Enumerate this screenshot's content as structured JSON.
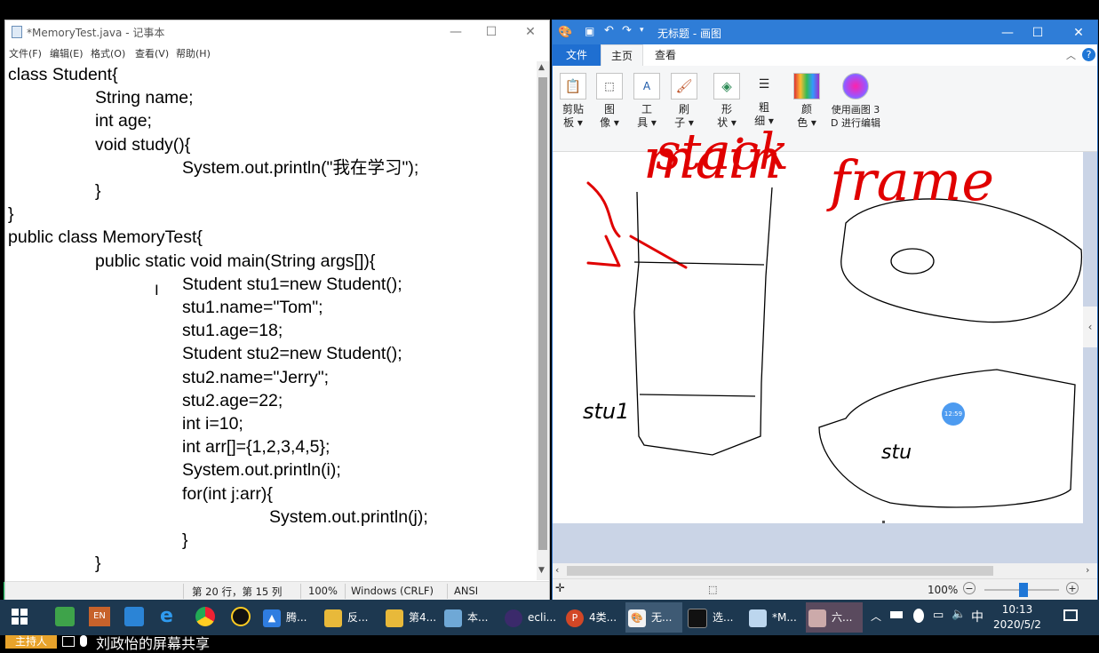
{
  "notepad": {
    "title": "*MemoryTest.java - 记事本",
    "menu": [
      "文件(F)",
      "编辑(E)",
      "格式(O)",
      "查看(V)",
      "帮助(H)"
    ],
    "code_lines": [
      "class Student{",
      "\t\tString name;",
      "\t\tint age;",
      "\t\tvoid study(){",
      "\t\t\t\tSystem.out.println(\"我在学习\");",
      "\t\t}",
      "}",
      "public class MemoryTest{",
      "\t\tpublic static void main(String args[]){",
      "\t\t\t\tStudent stu1=new Student();",
      "\t\t\t\tstu1.name=\"Tom\";",
      "\t\t\t\tstu1.age=18;",
      "\t\t\t\tStudent stu2=new Student();",
      "\t\t\t\tstu2.name=\"Jerry\";",
      "\t\t\t\tstu2.age=22;",
      "\t\t\t\tint i=10;",
      "\t\t\t\tint arr[]={1,2,3,4,5};",
      "\t\t\t\tSystem.out.println(i);",
      "\t\t\t\tfor(int j:arr){",
      "\t\t\t\t\t\tSystem.out.println(j);",
      "\t\t\t\t}",
      "\t\t}"
    ],
    "status": {
      "position": "第 20 行，第 15 列",
      "zoom": "100%",
      "line_ending": "Windows (CRLF)",
      "encoding": "ANSI"
    }
  },
  "paint": {
    "title": "无标题 - 画图",
    "tabs": [
      "文件",
      "主页",
      "查看"
    ],
    "ribbon": [
      {
        "line1": "剪贴",
        "line2": "板 ▾",
        "icon": "clipboard-icon"
      },
      {
        "line1": "图",
        "line2": "像 ▾",
        "icon": "image-select-icon"
      },
      {
        "line1": "工",
        "line2": "具 ▾",
        "icon": "tools-icon"
      },
      {
        "line1": "刷",
        "line2": "子 ▾",
        "icon": "brush-icon"
      },
      {
        "line1": "形",
        "line2": "状 ▾",
        "icon": "shapes-icon"
      },
      {
        "line1": "粗",
        "line2": "细 ▾",
        "icon": "size-icon"
      },
      {
        "line1": "颜",
        "line2": "色 ▾",
        "icon": "colors-icon"
      },
      {
        "line1": "使用画图 3",
        "line2": "D 进行编辑",
        "icon": "paint3d-icon"
      }
    ],
    "handwriting": {
      "main": "main",
      "stack": "stack",
      "frame": "frame",
      "stu1": "stu1",
      "stu": "stu"
    },
    "cursor_time": "12:59",
    "status_zoom": "100%"
  },
  "taskbar": {
    "apps": [
      "腾...",
      "反...",
      "第4...",
      "本...",
      "ecli...",
      "4类...",
      "无...",
      "选...",
      "*M...",
      "六..."
    ],
    "ime": "中",
    "time": "10:13",
    "date": "2020/5/2"
  },
  "share_bar": {
    "host": "主持人",
    "text": "刘政怡的屏幕共享"
  },
  "colors": {
    "paint_titlebar": "#2f7dd7",
    "taskbar": "#1d3850",
    "accent_green": "#1fd36a",
    "host_badge": "#e8a32b"
  }
}
